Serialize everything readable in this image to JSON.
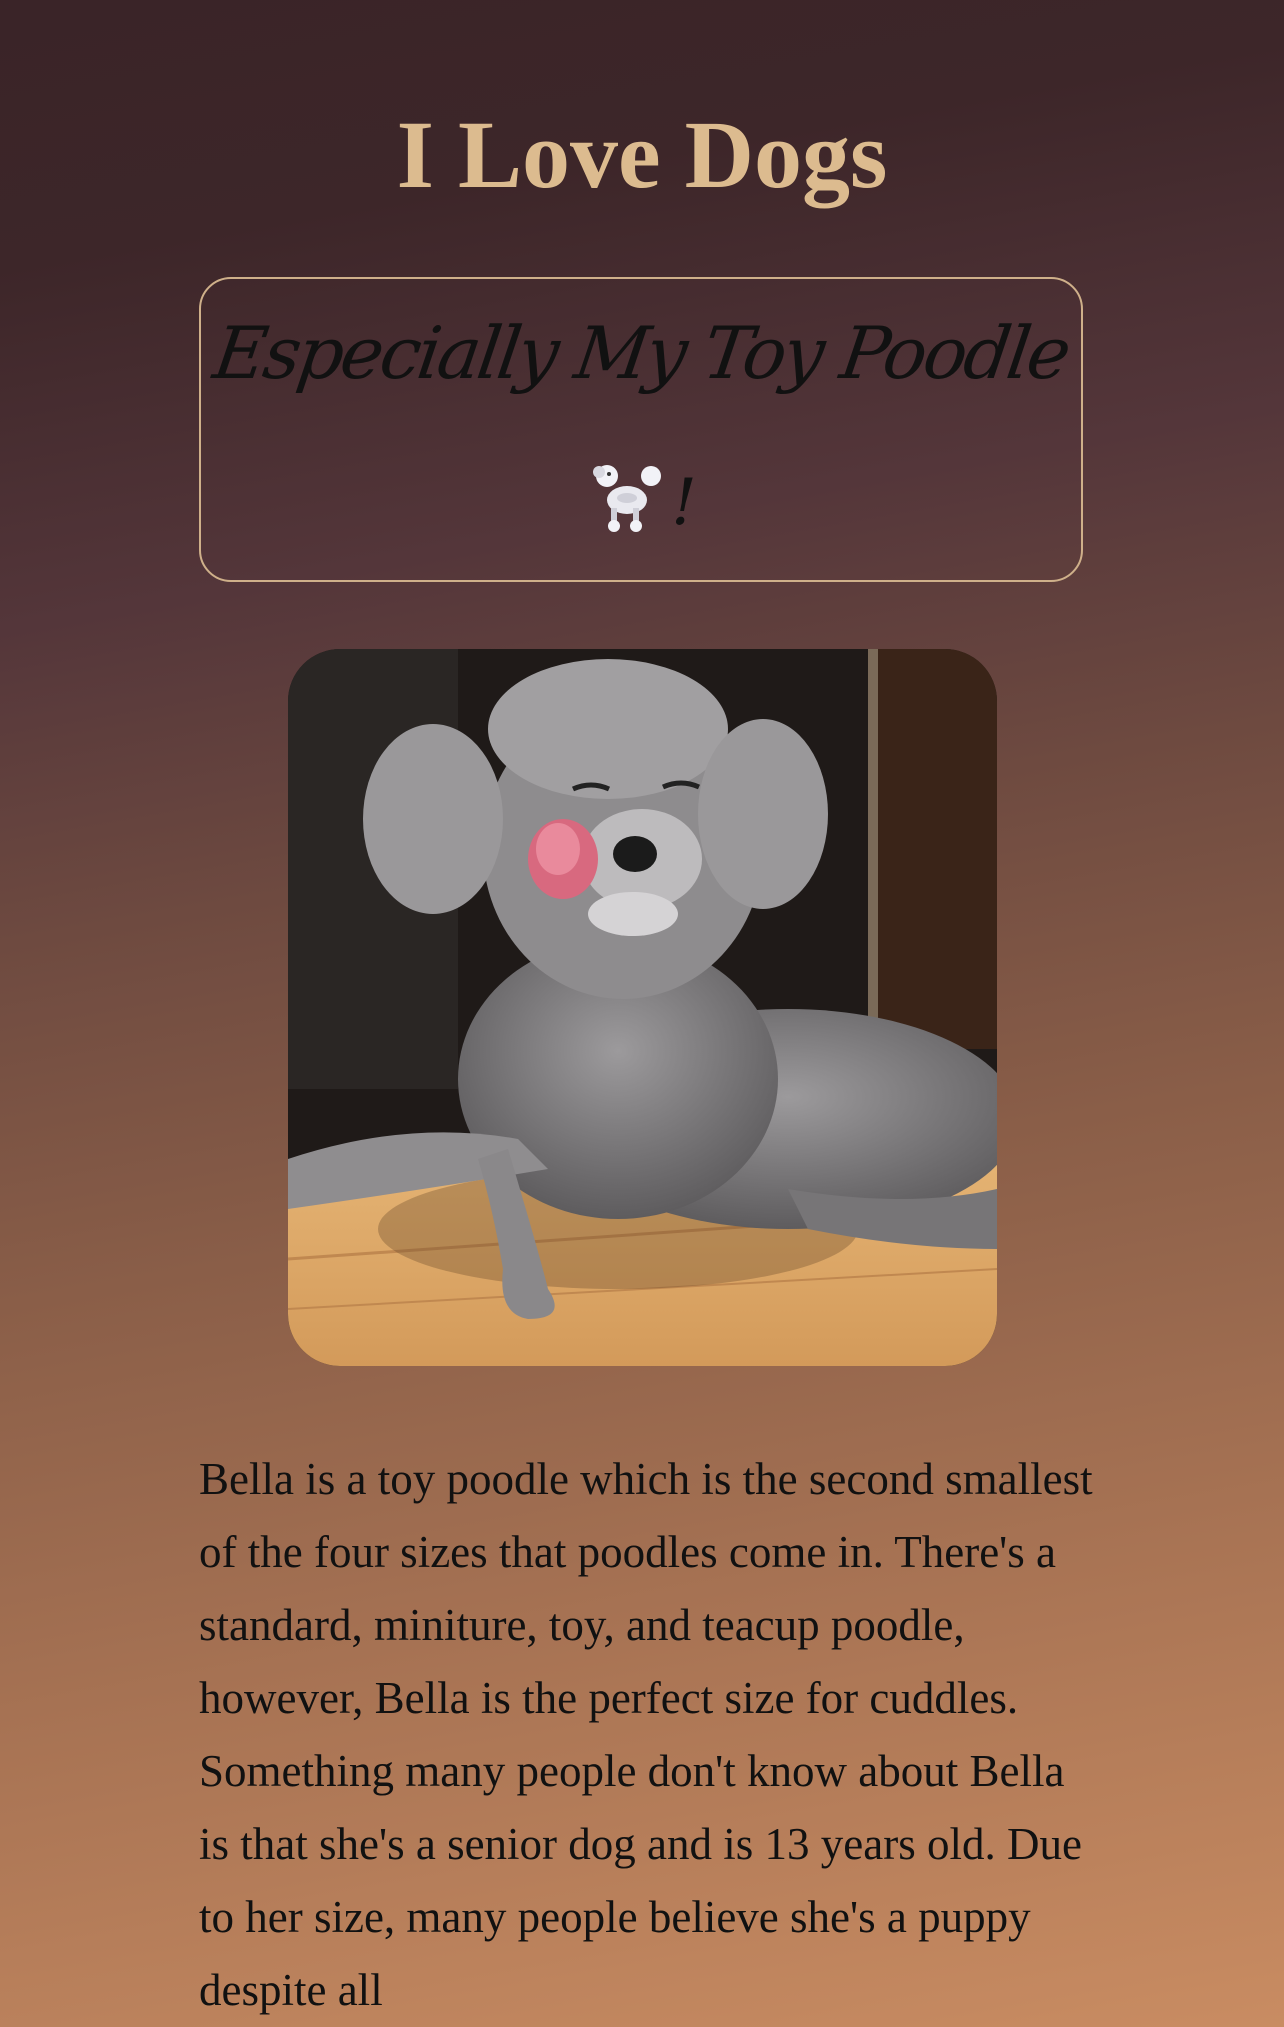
{
  "page": {
    "title": "I Love Dogs",
    "subtitle": "Especially My Toy Poodle",
    "subtitle_suffix": "!",
    "icons": {
      "subtitle_icon": "poodle-icon"
    },
    "photo": {
      "subject": "gray-toy-poodle"
    },
    "bio": "Bella is a toy poodle which is the second smallest of the four sizes that poodles come in. There's a standard, miniture, toy, and teacup poodle, however, Bella is the perfect size for cuddles. Something many people don't know about Bella is that she's a senior dog and is 13 years old. Due to her size, many people believe she's a puppy despite all"
  },
  "colors": {
    "title": "#dcbb8f",
    "box_border": "#cfb08a",
    "background_top": "#3a2428",
    "background_bottom": "#c98c62",
    "text": "#111111"
  }
}
